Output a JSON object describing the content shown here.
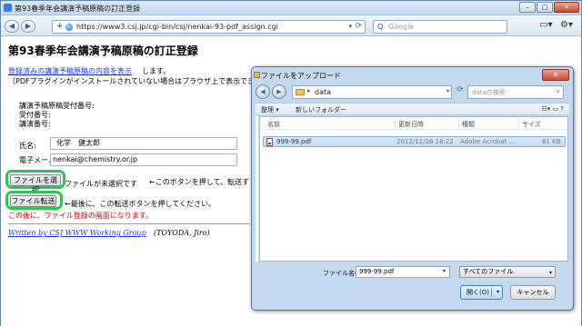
{
  "browser": {
    "tab_title": "第93春季年会講演予稿原稿の訂正登録",
    "url": "https://www3.csj.jp/cgi-bin/csj/nenkai-93-pdf_assign.cgi",
    "search_placeholder": "Google",
    "window_buttons": {
      "minimize": "–",
      "maximize": "□",
      "close": "✕"
    }
  },
  "page": {
    "title": "第93春季年会講演予稿原稿の訂正登録",
    "link_registered": "登録済みの講演予稿原稿の内容を表示",
    "link_suffix": "します。",
    "pdf_note": "（PDFプラグインがインストールされていない場合はブラウザ上で表示できませ",
    "receipt_label": "講演予稿原稿受付番号:",
    "reception_label": "受付番号:",
    "lecture_label": "講演番号:",
    "name_label": "氏名:",
    "name_value": "化学　健太郎",
    "email_label": "電子メール:",
    "email_value": "nenkai@chemistry.or.jp",
    "choose_file_button": "ファイルを選択",
    "file_status": "ファイルが未選択です",
    "hint_choose": "←このボタンを押して、転送する",
    "transfer_button": "ファイル転送",
    "hint_transfer": "←最後に、この転送ボタンを押してください。",
    "warning": "この後に、ファイル登録の画面になります。",
    "footer_link": "Written by CSJ WWW Working Group",
    "footer_author": "(TOYODA, Jiro)"
  },
  "dialog": {
    "title": "ファイルをアップロード",
    "path": "data",
    "search_placeholder": "dataの検索",
    "cmd_organize": "整理 ▾",
    "cmd_new_folder": "新しいフォルダー",
    "columns": [
      "名前",
      "更新日時",
      "種類",
      "サイズ"
    ],
    "files": [
      {
        "name": "999-99.pdf",
        "modified": "2012/12/18 18:22",
        "type": "Adobe Acrobat ...",
        "size": "81 KB"
      }
    ],
    "filename_label": "ファイル名(N):",
    "filename_value": "999-99.pdf",
    "filetype": "すべてのファイル",
    "open_button": "開く(O)",
    "cancel_button": "キャンセル"
  },
  "colors": {
    "link": "#1b33d6",
    "warning": "#d40000",
    "highlight": "#2cc653"
  }
}
